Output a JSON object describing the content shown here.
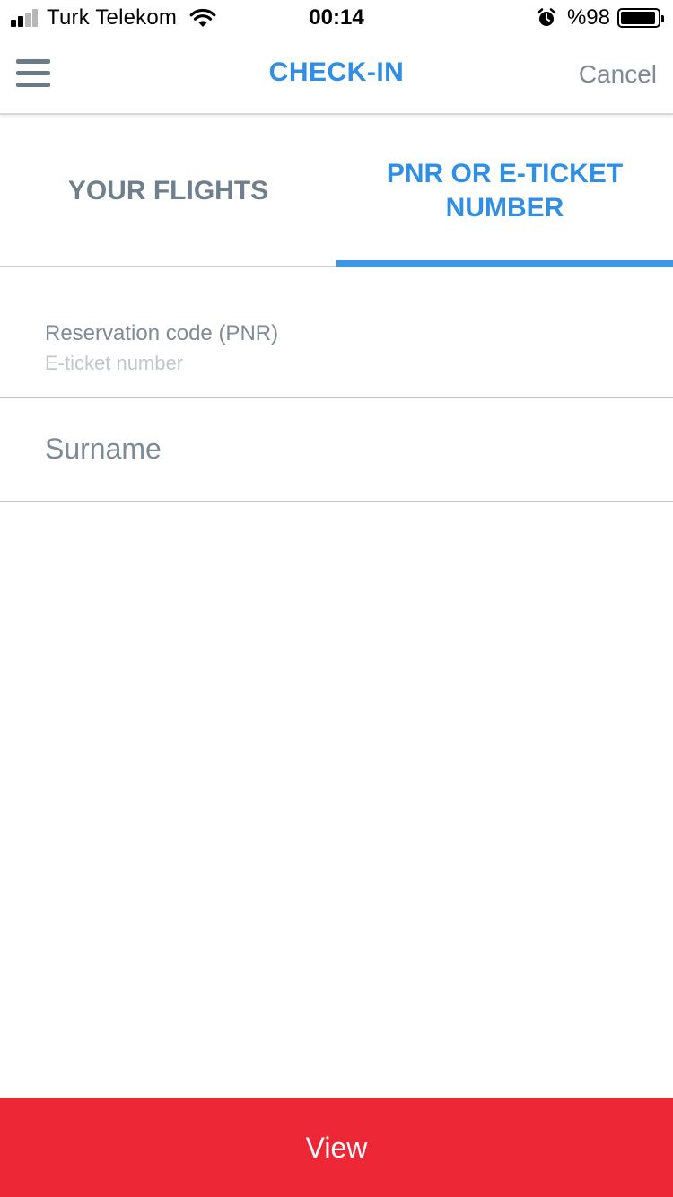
{
  "status_bar": {
    "carrier": "Turk Telekom",
    "time": "00:14",
    "battery_percent": "%98",
    "signal_bars": 4,
    "signal_active": 2,
    "icons": [
      "signal-icon",
      "wifi-icon",
      "alarm-icon",
      "battery-icon"
    ]
  },
  "nav": {
    "title": "CHECK-IN",
    "cancel_label": "Cancel",
    "menu_icon": "hamburger-menu-icon"
  },
  "tabs": [
    {
      "label": "YOUR FLIGHTS",
      "active": false
    },
    {
      "label": "PNR OR E-TICKET NUMBER",
      "active": true
    }
  ],
  "form": {
    "pnr_label": "Reservation code (PNR)",
    "pnr_placeholder": "E-ticket number",
    "surname_placeholder": "Surname"
  },
  "actions": {
    "view_label": "View"
  },
  "colors": {
    "accent_blue": "#2f8fe6",
    "button_red": "#ee2737",
    "muted_text": "#7e8a96"
  }
}
